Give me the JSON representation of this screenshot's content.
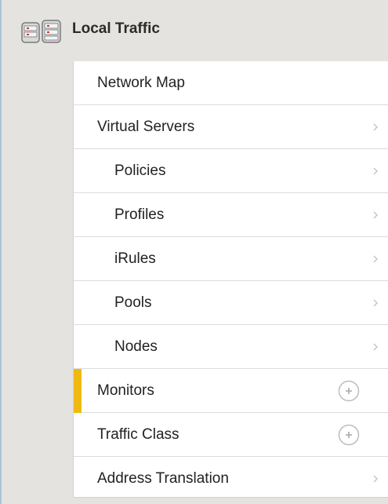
{
  "header": {
    "title": "Local Traffic",
    "icon": "servers-icon"
  },
  "menu": {
    "accent_color": "#f0b912",
    "items": [
      {
        "label": "Network Map",
        "level": "top",
        "control": "none"
      },
      {
        "label": "Virtual Servers",
        "level": "top",
        "control": "chevron"
      },
      {
        "label": "Policies",
        "level": "sub",
        "control": "chevron"
      },
      {
        "label": "Profiles",
        "level": "sub",
        "control": "chevron"
      },
      {
        "label": "iRules",
        "level": "sub",
        "control": "chevron"
      },
      {
        "label": "Pools",
        "level": "sub",
        "control": "chevron"
      },
      {
        "label": "Nodes",
        "level": "sub",
        "control": "chevron"
      },
      {
        "label": "Monitors",
        "level": "top",
        "control": "plus",
        "selected": true
      },
      {
        "label": "Traffic Class",
        "level": "top",
        "control": "plus"
      },
      {
        "label": "Address Translation",
        "level": "top",
        "control": "chevron"
      }
    ]
  }
}
